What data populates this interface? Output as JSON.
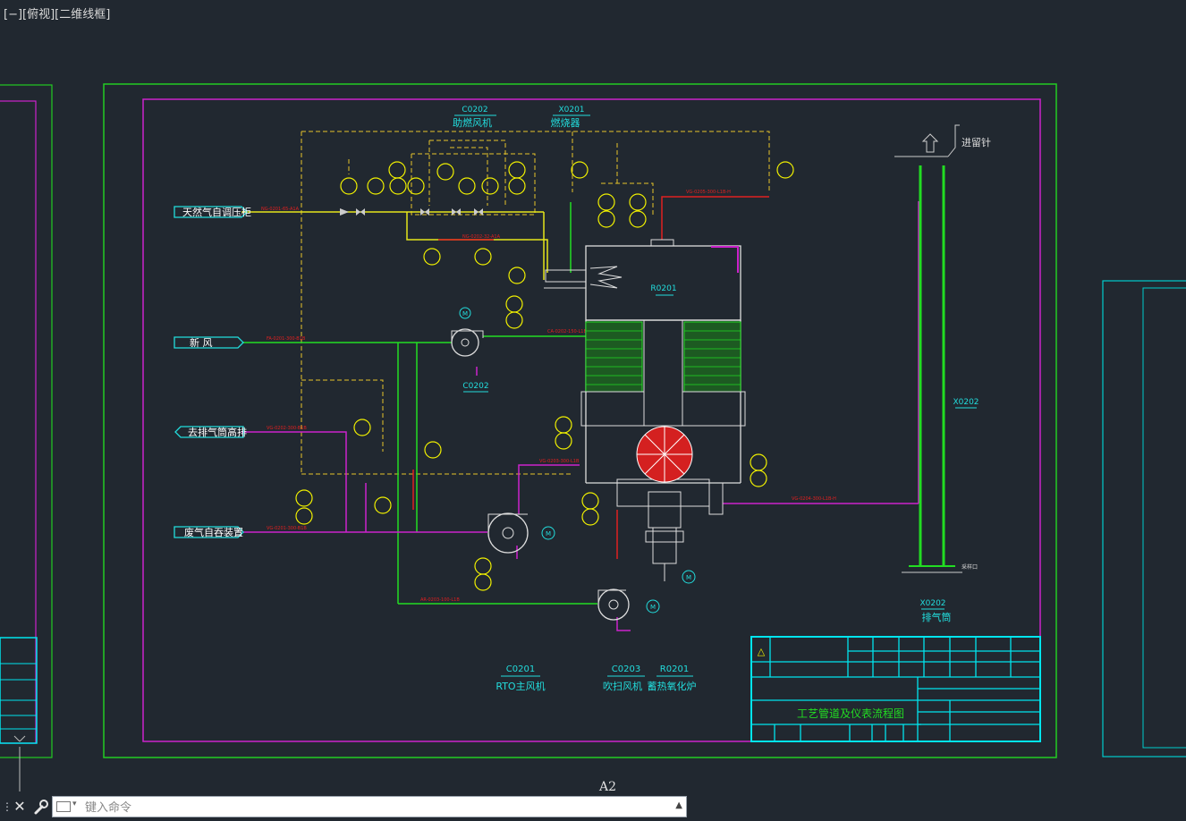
{
  "viewport": {
    "label": "[−][俯视][二维线框]"
  },
  "colors": {
    "background": "#212830",
    "frame_green": "#22cc22",
    "border_magenta": "#cc22cc",
    "title_block": "#00e5ee",
    "pipe_yellow": "#e6e61a",
    "pipe_green": "#22dd22",
    "pipe_red": "#e02020",
    "instrument": "#f0f000",
    "label_cyan": "#22dddd"
  },
  "equipment": {
    "c0202_tag": "C0202",
    "c0202_name": "助燃风机",
    "x0201_tag": "X0201",
    "x0201_name": "燃烧器",
    "r0201_tag": "R0201",
    "x0202_tag": "X0202",
    "x0202_name": "排气筒",
    "c0202_fan_tag": "C0202",
    "sampling_port": "采样口",
    "vent_label": "进留针",
    "bottom_c0201_tag": "C0201",
    "bottom_c0201_name": "RTO主风机",
    "bottom_c0203_tag": "C0203",
    "bottom_c0203_name": "吹扫风机",
    "bottom_r0201_tag": "R0201",
    "bottom_r0201_name": "蓄热氧化炉"
  },
  "streams": {
    "natural_gas": "天然气自调压柜",
    "fresh_air": "新  风",
    "to_stack": "去排气筒高排",
    "waste_gas": "废气自吞装置"
  },
  "title_block": {
    "drawing_title": "工艺管道及仪表流程图",
    "warning_symbol": "△"
  },
  "command_line": {
    "placeholder": "键入命令",
    "close_icon": "close-icon",
    "settings_icon": "wrench-icon"
  },
  "paper": {
    "size_label": "A2"
  }
}
